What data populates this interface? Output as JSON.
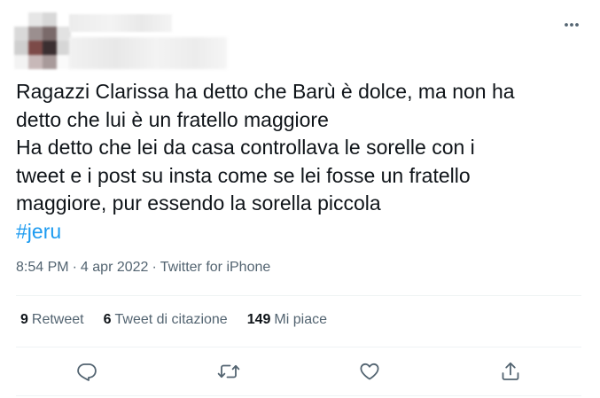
{
  "tweet": {
    "text_lines": [
      "Ragazzi Clarissa ha detto che Barù è dolce, ma non ha",
      "detto che lui è un fratello maggiore",
      "Ha detto che lei da casa controllava le sorelle con i",
      "tweet e i post su insta come se lei fosse un fratello",
      "maggiore, pur essendo la sorella piccola"
    ],
    "hashtag": "#jeru",
    "time": "8:54 PM",
    "separator": "·",
    "date": "4 apr 2022",
    "source": "Twitter for iPhone"
  },
  "stats": {
    "retweets": {
      "count": "9",
      "label": "Retweet"
    },
    "quotes": {
      "count": "6",
      "label": "Tweet di citazione"
    },
    "likes": {
      "count": "149",
      "label": "Mi piace"
    }
  },
  "icons": {
    "more": "more-horizontal-icon",
    "reply": "reply-icon",
    "retweet": "retweet-icon",
    "like": "heart-icon",
    "share": "share-icon"
  },
  "colors": {
    "text": "#0f1419",
    "secondary": "#536471",
    "link": "#1d9bf0",
    "divider": "#eff3f4"
  }
}
